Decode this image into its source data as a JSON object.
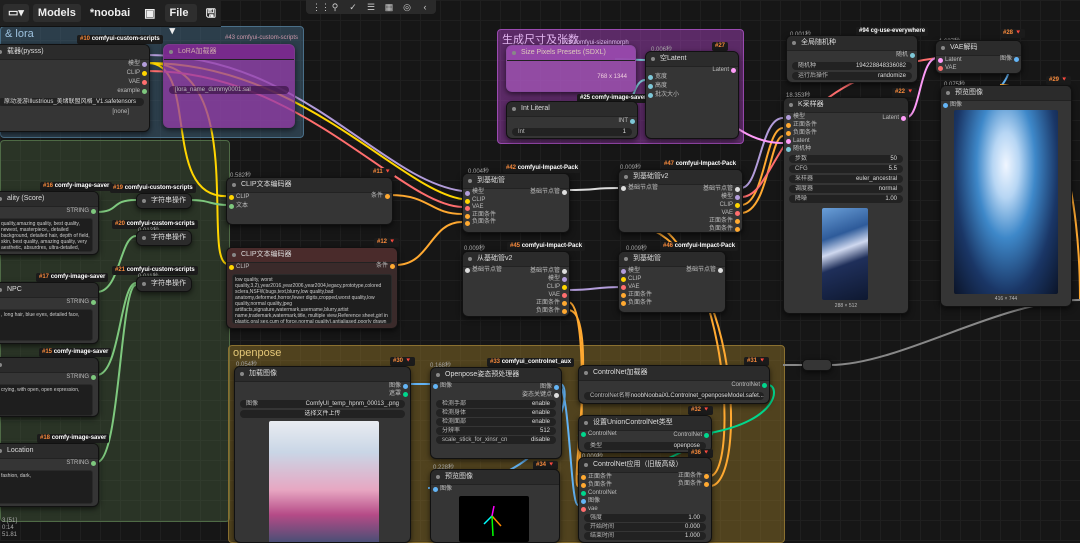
{
  "toolbar": {
    "models_label": "Models",
    "workflow_name": "*noobai",
    "file_label": "File",
    "file_chevron": "▾",
    "folder_icon": "▭▾"
  },
  "iconbar": {
    "icons": [
      "⋮⋮",
      "⚲",
      "✓",
      "☰",
      "▦",
      "◎",
      "‹"
    ]
  },
  "groups": {
    "lora": "& lora",
    "size": "生成尺寸及张数",
    "openpose": "openpose"
  },
  "nodes": {
    "lora_loader": {
      "badge_id": "#10",
      "badge_pack": "comfyui-custom-scripts",
      "title": "载器(pysss)",
      "outputs": [
        "模型",
        "CLIP",
        "VAE",
        "example"
      ],
      "w1_value": "原动漫游Illustrious_美绪联盟风格_V1.safetensors",
      "w2_value": "[none]"
    },
    "lora_inner": {
      "badge": "#43 comfyui-custom-scripts",
      "title": "LoRA加载器",
      "widget": "[lora_name_dummy0001.sal"
    },
    "save16": {
      "badge_id": "#16",
      "badge_pack": "comfy-image-saver",
      "title": "ality (Score)",
      "output": "STRING",
      "text": "quality,amazing quality, best quality, newest, masterpiece,, detailed background, detailed hair, depth of field, skin, best quality, amazing quality, very aesthetic, absurdres, ultra-detailed, absurdres, incredibly absurdres"
    },
    "save17": {
      "badge_id": "#17",
      "badge_pack": "comfy-image-saver",
      "title": "NPC",
      "output": "STRING",
      "text": ", long hair, blue eyes, detailed face,"
    },
    "save15": {
      "badge_id": "#15",
      "badge_pack": "comfy-image-saver",
      "output": "STRING",
      "text": "crying, with open, open expression,"
    },
    "save18": {
      "badge_id": "#18",
      "badge_pack": "comfy-image-saver",
      "title": "Location",
      "output": "STRING",
      "text": "fashion, dark,"
    },
    "ss19": {
      "badge_id": "#19",
      "badge_pack": "comfyui-custom-scripts",
      "title": "字符串操作"
    },
    "ss20": {
      "badge_id": "#20",
      "badge_pack": "comfyui-custom-scripts",
      "title": "字符串操作",
      "id": "0.013秒"
    },
    "ss21": {
      "badge_id": "#21",
      "badge_pack": "comfyui-custom-scripts",
      "title": "字符串操作",
      "id": "0.011秒"
    },
    "clip11": {
      "id": "0.582秒",
      "badge_id": "#11",
      "title": "CLIP文本编码器",
      "inputs": [
        "CLIP",
        "文本"
      ],
      "output": "条件"
    },
    "clip12": {
      "badge_id": "#12",
      "title": "CLIP文本编码器",
      "inputs": [
        "CLIP"
      ],
      "output": "条件",
      "text": "low quality, worst quality,3,2),year2016,year2006,year2004,legacy,prototype,colored sclera,NSFW,bugs,text,blurry,low quality,bad anatomy,deformed,horror,fewer digits,cropped,worst quality,low quality,normal quality,jpeg artifacts,signature,watermark,username,blurry,artist name,trademark,watermark,title, multiple view,Reference sheet,girl in plastic,oral sex,cum of force,normal quality),antialiased,poorly drawn face,bones,"
    },
    "ksetup42": {
      "id": "0.004秒",
      "badge_id": "#42",
      "badge_pack": "comfyui-Impact-Pack",
      "title": "到基础管",
      "inputs": [
        "模型",
        "CLIP",
        "VAE",
        "正面条件",
        "负面条件"
      ],
      "output": "基础节点管"
    },
    "latent27": {
      "badge_id": "#27",
      "title": "空Latent",
      "id": "0.006秒",
      "inputs": [
        "宽度",
        "高度",
        "批次大小"
      ],
      "output": "Latent"
    },
    "size_preset": {
      "title": "Size Pixels Presets (SDXL)",
      "pack": "#28 comfyui-sizeinmorph",
      "row2": "768 x 1344"
    },
    "intlit": {
      "title": "Int Literal",
      "badge": "#25 comfy-image-saver",
      "output": "INT",
      "widget_label": "Int",
      "widget_value": "1"
    },
    "ksetup47": {
      "id": "0.009秒",
      "badge_id": "#47",
      "badge_pack": "comfyui-Impact-Pack",
      "title": "到基础管v2",
      "input": "基础节点管",
      "outputs": [
        "基础节点管",
        "模型",
        "CLIP",
        "VAE",
        "正面条件",
        "负面条件"
      ]
    },
    "from45": {
      "id": "0.009秒",
      "badge_id": "#45",
      "badge_pack": "comfyui-Impact-Pack",
      "title": "从基础管v2",
      "input": "基础节点管",
      "outputs": [
        "基础节点管",
        "模型",
        "CLIP",
        "VAE",
        "正面条件",
        "负面条件"
      ]
    },
    "from46": {
      "id": "0.009秒",
      "badge_id": "#46",
      "badge_pack": "comfyui-Impact-Pack",
      "title": "到基础管",
      "inputs": [
        "模型",
        "CLIP",
        "VAE",
        "正面条件",
        "负面条件"
      ],
      "output": "基础节点管"
    },
    "seed": {
      "id": "0.001秒",
      "badge": "#94 cg-use-everywhere",
      "title": "全局随机种",
      "output": "随机",
      "w1_label": "随机种",
      "w1_value": "194228848336082",
      "w2_label": "运行后操作",
      "w2_value": "randomize"
    },
    "ksampler22": {
      "id": "18.353秒",
      "badge_id": "#22",
      "title": "K采样器",
      "inputs": [
        "模型",
        "正面条件",
        "负面条件",
        "Latent"
      ],
      "output": "Latent",
      "subtitle": "随机种",
      "widgets": [
        {
          "l": "步数",
          "v": "50"
        },
        {
          "l": "CFG",
          "v": "5.5"
        },
        {
          "l": "采样器",
          "v": "euler_ancestral"
        },
        {
          "l": "调度器",
          "v": "normal"
        },
        {
          "l": "降噪",
          "v": "1.00"
        }
      ],
      "preview_caption": "288 × 512"
    },
    "vae28": {
      "id": "1.637秒",
      "badge_id": "#28",
      "title": "VAE解码",
      "inputs": [
        "Latent",
        "VAE"
      ],
      "output": "图像"
    },
    "preview29": {
      "id": "0.075秒",
      "badge_id": "#29",
      "title": "预览图像",
      "input": "图像",
      "caption": "416 × 744"
    },
    "load30": {
      "id": "0.054秒",
      "badge_id": "#30",
      "title": "加载图像",
      "outputs": [
        "图像",
        "遮罩"
      ],
      "w1_label": "图像",
      "w1_value": "ComfyUI_temp_hpnm_00013_.png",
      "upload": "选择文件上传"
    },
    "pose33": {
      "id": "0.168秒",
      "badge_id": "#33",
      "badge_pack": "comfyui_controlnet_aux",
      "title": "Openpose姿态预处理器",
      "input": "图像",
      "outputs": [
        "图像",
        "姿态关键点"
      ],
      "widgets": [
        {
          "l": "检测手部",
          "v": "enable"
        },
        {
          "l": "检测身体",
          "v": "enable"
        },
        {
          "l": "检测面部",
          "v": "enable"
        },
        {
          "l": "分辨率",
          "v": "512"
        },
        {
          "l": "",
          "v": "disable"
        }
      ],
      "w_scale": "scale_stick_for_xinsr_cn"
    },
    "preview34": {
      "id": "0.228秒",
      "badge_id": "#34",
      "title": "预览图像",
      "input": "图像"
    },
    "cnload31": {
      "badge_id": "#31",
      "title": "ControlNet加载器",
      "output": "ControlNet",
      "w_label": "ControlNet名称",
      "w_value": "noobNoobaiXLControlnet_openposeModel.safet..."
    },
    "union32": {
      "badge_id": "#32",
      "title": "设置UnionControlNet类型",
      "input": "ControlNet",
      "output": "ControlNet",
      "w_label": "类型",
      "w_value": "openpose"
    },
    "apply36": {
      "id": "0.009秒",
      "badge_id": "#36",
      "title": "ControlNet应用（旧版高级）",
      "inputs": [
        "正面条件",
        "负面条件",
        "ControlNet",
        "图像",
        "vae"
      ],
      "outputs": [
        "正面条件",
        "负面条件"
      ],
      "widgets": [
        {
          "l": "强度",
          "v": "1.00"
        },
        {
          "l": "开始时间",
          "v": "0.000"
        },
        {
          "l": "结束时间",
          "v": "1.000"
        }
      ]
    }
  },
  "footer": {
    "line1": "3 [51]",
    "line2": "0:14",
    "line3": "51.81"
  }
}
